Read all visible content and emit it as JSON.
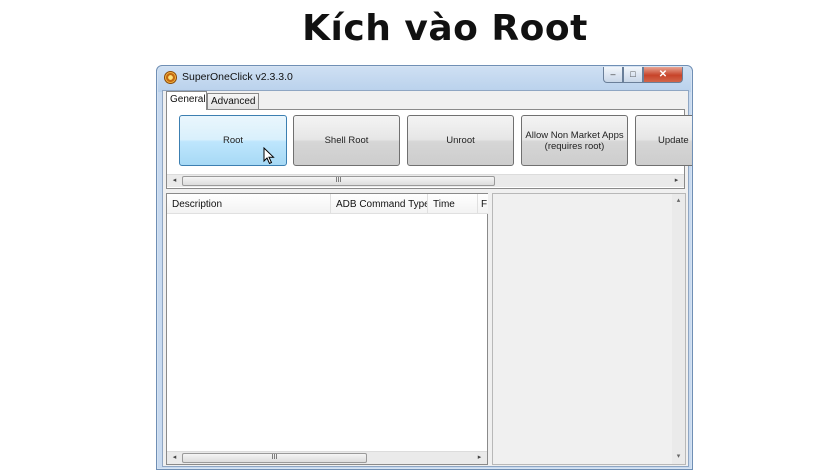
{
  "headline": "Kích vào Root",
  "window": {
    "title": "SuperOneClick v2.3.3.0",
    "controls": {
      "minimize": "–",
      "maximize": "□",
      "close": "✕"
    }
  },
  "tabs": [
    {
      "label": "General",
      "active": true
    },
    {
      "label": "Advanced",
      "active": false
    }
  ],
  "toolbar": {
    "buttons": [
      {
        "label": "Root",
        "highlighted": true
      },
      {
        "label": "Shell Root"
      },
      {
        "label": "Unroot"
      },
      {
        "label": "Allow Non Market Apps\n(requires root)"
      },
      {
        "label": "Update"
      }
    ]
  },
  "scrollbar": {
    "left_arrow": "◂",
    "right_arrow": "▸",
    "thumb_grip": "III",
    "up_arrow": "▴",
    "down_arrow": "▾"
  },
  "log_table": {
    "columns": [
      "Description",
      "ADB Command Type",
      "Time",
      "F"
    ],
    "rows": []
  },
  "colors": {
    "hot_button": "#bee6fd",
    "title_bar": "#b9d1ec",
    "close_button": "#c7442a"
  },
  "icons": [
    "app-icon",
    "mouse-cursor-icon",
    "scroll-left-icon",
    "scroll-right-icon",
    "scroll-up-icon",
    "scroll-down-icon"
  ]
}
